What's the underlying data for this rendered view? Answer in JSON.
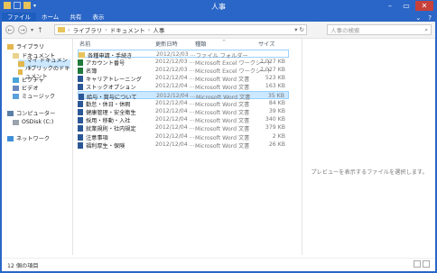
{
  "window": {
    "title": "人事"
  },
  "ribbon": {
    "tabs": [
      "ファイル",
      "ホーム",
      "共有",
      "表示"
    ]
  },
  "address": {
    "crumbs": [
      "ライブラリ",
      "ドキュメント",
      "人事"
    ],
    "search_placeholder": "人事の検索"
  },
  "nav_pane": {
    "items": [
      {
        "label": "ライブラリ",
        "icon": "library-icon"
      },
      {
        "label": "ドキュメント",
        "icon": "documents-icon"
      },
      {
        "label": "マイ ドキュメント",
        "icon": "folder-icon",
        "selected": true
      },
      {
        "label": "パブリックのドキュメント",
        "icon": "folder-icon"
      },
      {
        "label": "ピクチャ",
        "icon": "pictures-icon"
      },
      {
        "label": "ビデオ",
        "icon": "videos-icon"
      },
      {
        "label": "ミュージック",
        "icon": "music-icon"
      },
      {
        "label": "コンピューター",
        "icon": "computer-icon"
      },
      {
        "label": "OSDisk (C:)",
        "icon": "disk-icon"
      },
      {
        "label": "ネットワーク",
        "icon": "network-icon"
      }
    ]
  },
  "columns": {
    "name": "名前",
    "date": "更新日時",
    "type": "種類",
    "size": "サイズ"
  },
  "files": [
    {
      "name": "各種申請・手続き",
      "date": "2012/12/03 ...",
      "type": "ファイル フォルダー",
      "size": "",
      "kind": "folder"
    },
    {
      "name": "アカウント番号",
      "date": "2012/12/03 ...",
      "type": "Microsoft Excel ワークシート",
      "size": "2,027 KB",
      "kind": "xls"
    },
    {
      "name": "名簿",
      "date": "2012/12/03 ...",
      "type": "Microsoft Excel ワークシート",
      "size": "2,027 KB",
      "kind": "xls"
    },
    {
      "name": "キャリアトレーニング",
      "date": "2012/12/04 ...",
      "type": "Microsoft Word 文書",
      "size": "523 KB",
      "kind": "doc"
    },
    {
      "name": "ストックオプション",
      "date": "2012/12/04 ...",
      "type": "Microsoft Word 文書",
      "size": "163 KB",
      "kind": "doc"
    },
    {
      "name": "給与・賞与について",
      "date": "2012/12/04 ...",
      "type": "Microsoft Word 文書",
      "size": "35 KB",
      "kind": "doc",
      "selected": true
    },
    {
      "name": "勤怠・休日・休暇",
      "date": "2012/12/04 ...",
      "type": "Microsoft Word 文書",
      "size": "84 KB",
      "kind": "doc"
    },
    {
      "name": "健康管理・安全衛生",
      "date": "2012/12/04 ...",
      "type": "Microsoft Word 文書",
      "size": "39 KB",
      "kind": "doc"
    },
    {
      "name": "採用・移動・入社",
      "date": "2012/12/04 ...",
      "type": "Microsoft Word 文書",
      "size": "340 KB",
      "kind": "doc"
    },
    {
      "name": "就業規則・社内規定",
      "date": "2012/12/04 ...",
      "type": "Microsoft Word 文書",
      "size": "379 KB",
      "kind": "doc"
    },
    {
      "name": "注意事項",
      "date": "2012/12/04 ...",
      "type": "Microsoft Word 文書",
      "size": "2 KB",
      "kind": "doc"
    },
    {
      "name": "福利厚生・保険",
      "date": "2012/12/04 ...",
      "type": "Microsoft Word 文書",
      "size": "26 KB",
      "kind": "doc"
    }
  ],
  "preview": {
    "message": "プレビューを表示するファイルを選択します。"
  },
  "status": {
    "text": "12 個の項目"
  }
}
